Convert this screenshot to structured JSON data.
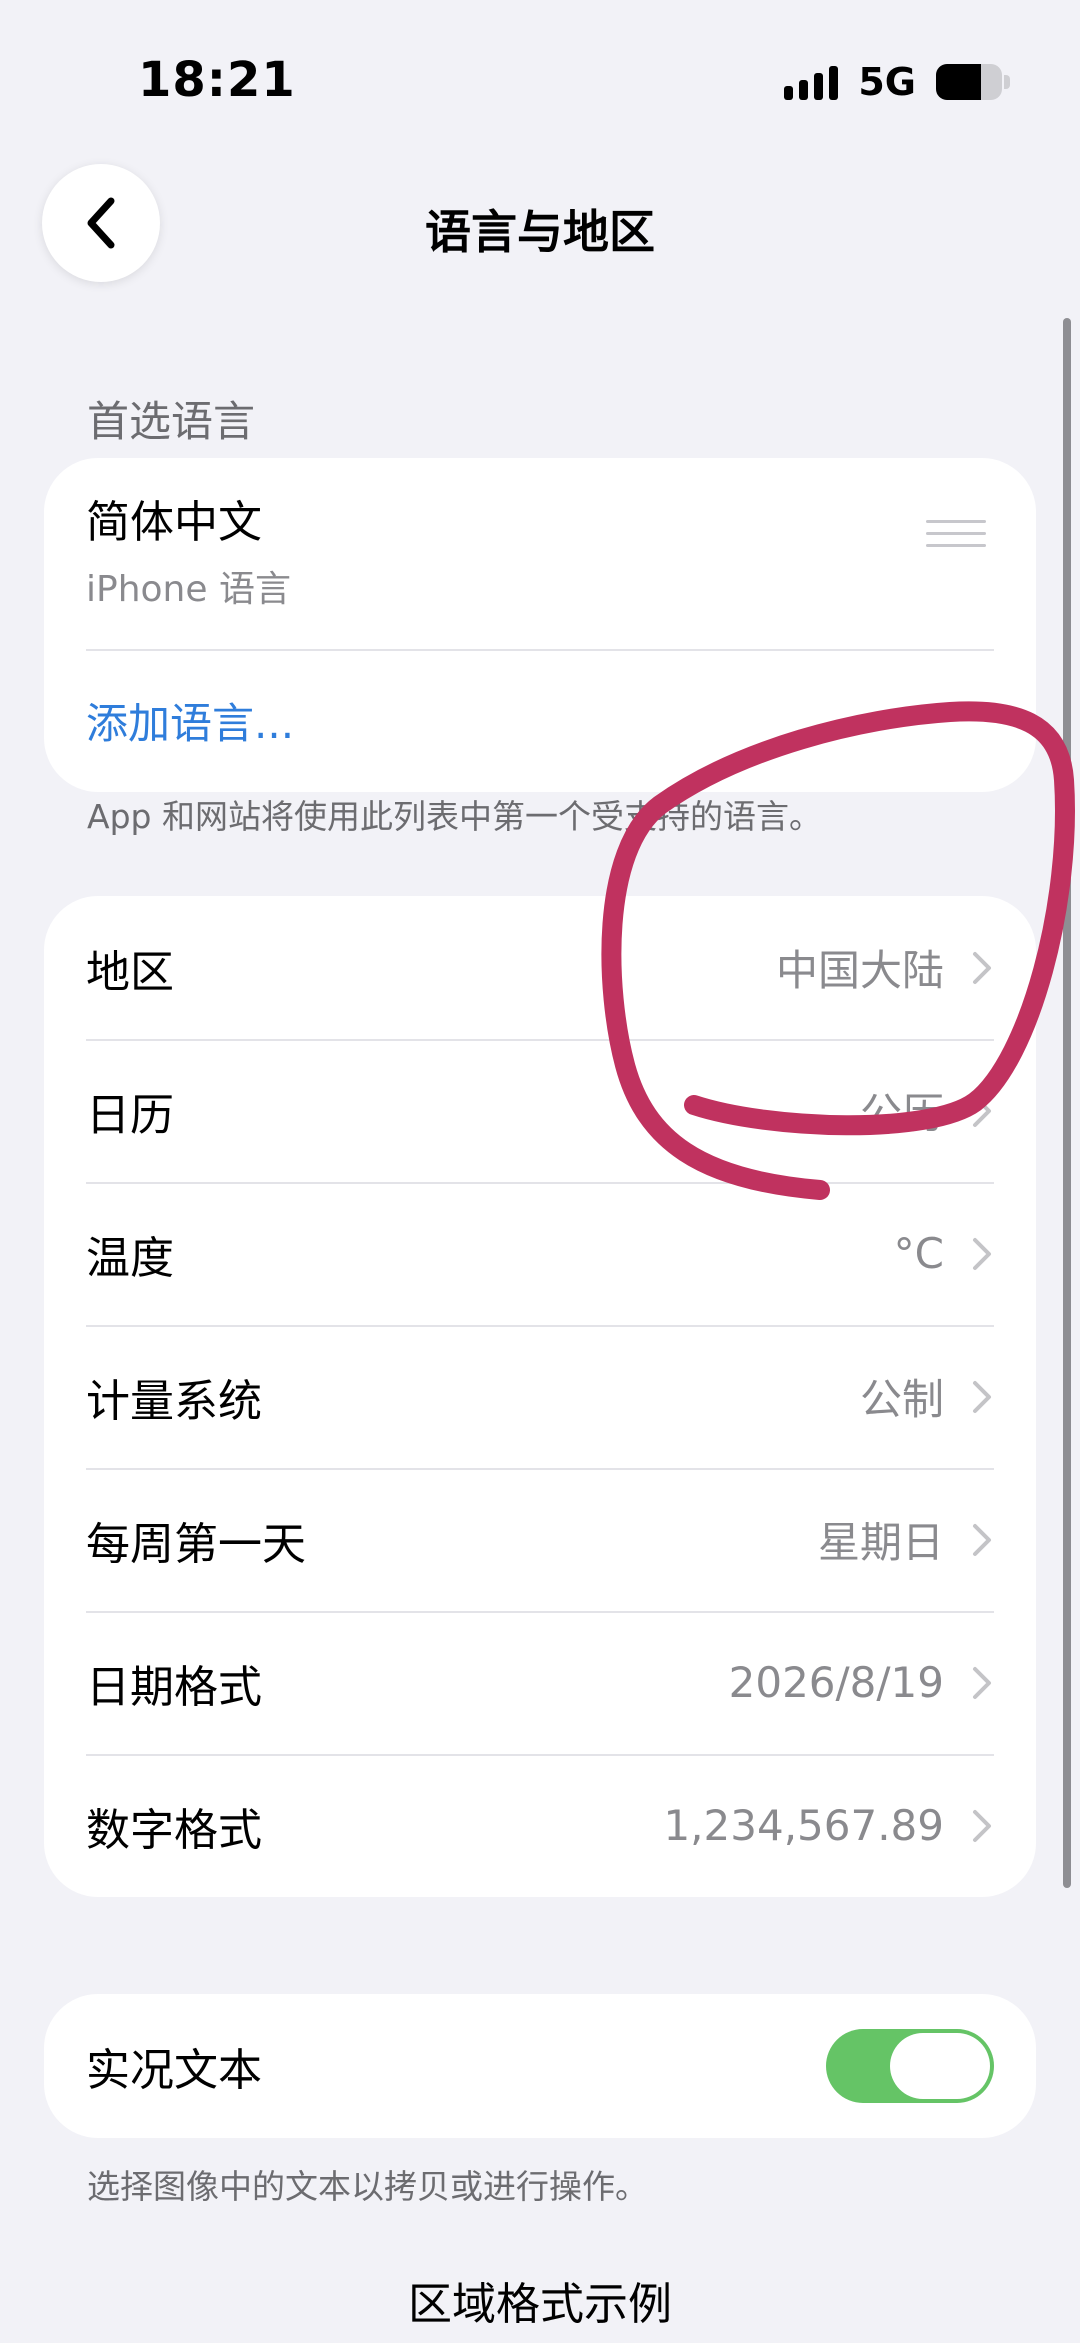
{
  "status_bar": {
    "time": "18:21",
    "network": "5G",
    "battery_level": 0.68
  },
  "nav": {
    "title": "语言与地区",
    "back_icon": "chevron-left-icon"
  },
  "preferred_languages": {
    "header": "首选语言",
    "languages": [
      {
        "name": "简体中文",
        "subtitle": "iPhone 语言"
      }
    ],
    "add_label": "添加语言...",
    "footer": "App 和网站将使用此列表中第一个受支持的语言。"
  },
  "region_settings": {
    "rows": [
      {
        "label": "地区",
        "value": "中国大陆"
      },
      {
        "label": "日历",
        "value": "公历"
      },
      {
        "label": "温度",
        "value": "°C"
      },
      {
        "label": "计量系统",
        "value": "公制"
      },
      {
        "label": "每周第一天",
        "value": "星期日"
      },
      {
        "label": "日期格式",
        "value": "2026/8/19"
      },
      {
        "label": "数字格式",
        "value": "1,234,567.89"
      }
    ]
  },
  "live_text": {
    "label": "实况文本",
    "enabled": true,
    "footer": "选择图像中的文本以拷贝或进行操作。"
  },
  "region_format_example": {
    "title": "区域格式示例"
  },
  "colors": {
    "accent_blue": "#2F7DDB",
    "toggle_green": "#65C466",
    "annotation": "#C0325F",
    "background": "#F2F2F7"
  }
}
